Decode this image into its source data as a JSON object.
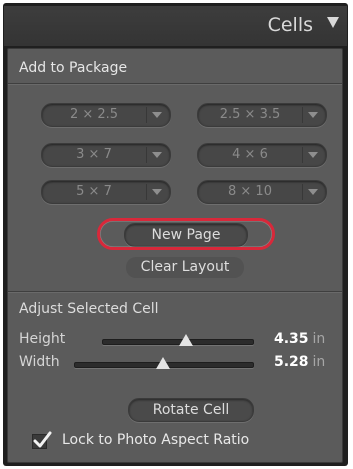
{
  "header": {
    "title": "Cells"
  },
  "add_to_package": {
    "title": "Add to Package",
    "sizes": [
      "2 × 2.5",
      "2.5 × 3.5",
      "3 × 7",
      "4 × 6",
      "5 × 7",
      "8 × 10"
    ],
    "new_page_label": "New Page",
    "clear_layout_label": "Clear Layout"
  },
  "adjust_cell": {
    "title": "Adjust Selected Cell",
    "height": {
      "label": "Height",
      "value": "4.35",
      "unit": "in",
      "level": 0.56
    },
    "width": {
      "label": "Width",
      "value": "5.28",
      "unit": "in",
      "level": 0.5
    },
    "rotate_label": "Rotate Cell"
  },
  "lock_aspect": {
    "label": "Lock to Photo Aspect Ratio",
    "checked": true
  },
  "colors": {
    "highlight": "#d8283a",
    "panel": "#5b5b5b",
    "header": "#3a3a3a"
  }
}
